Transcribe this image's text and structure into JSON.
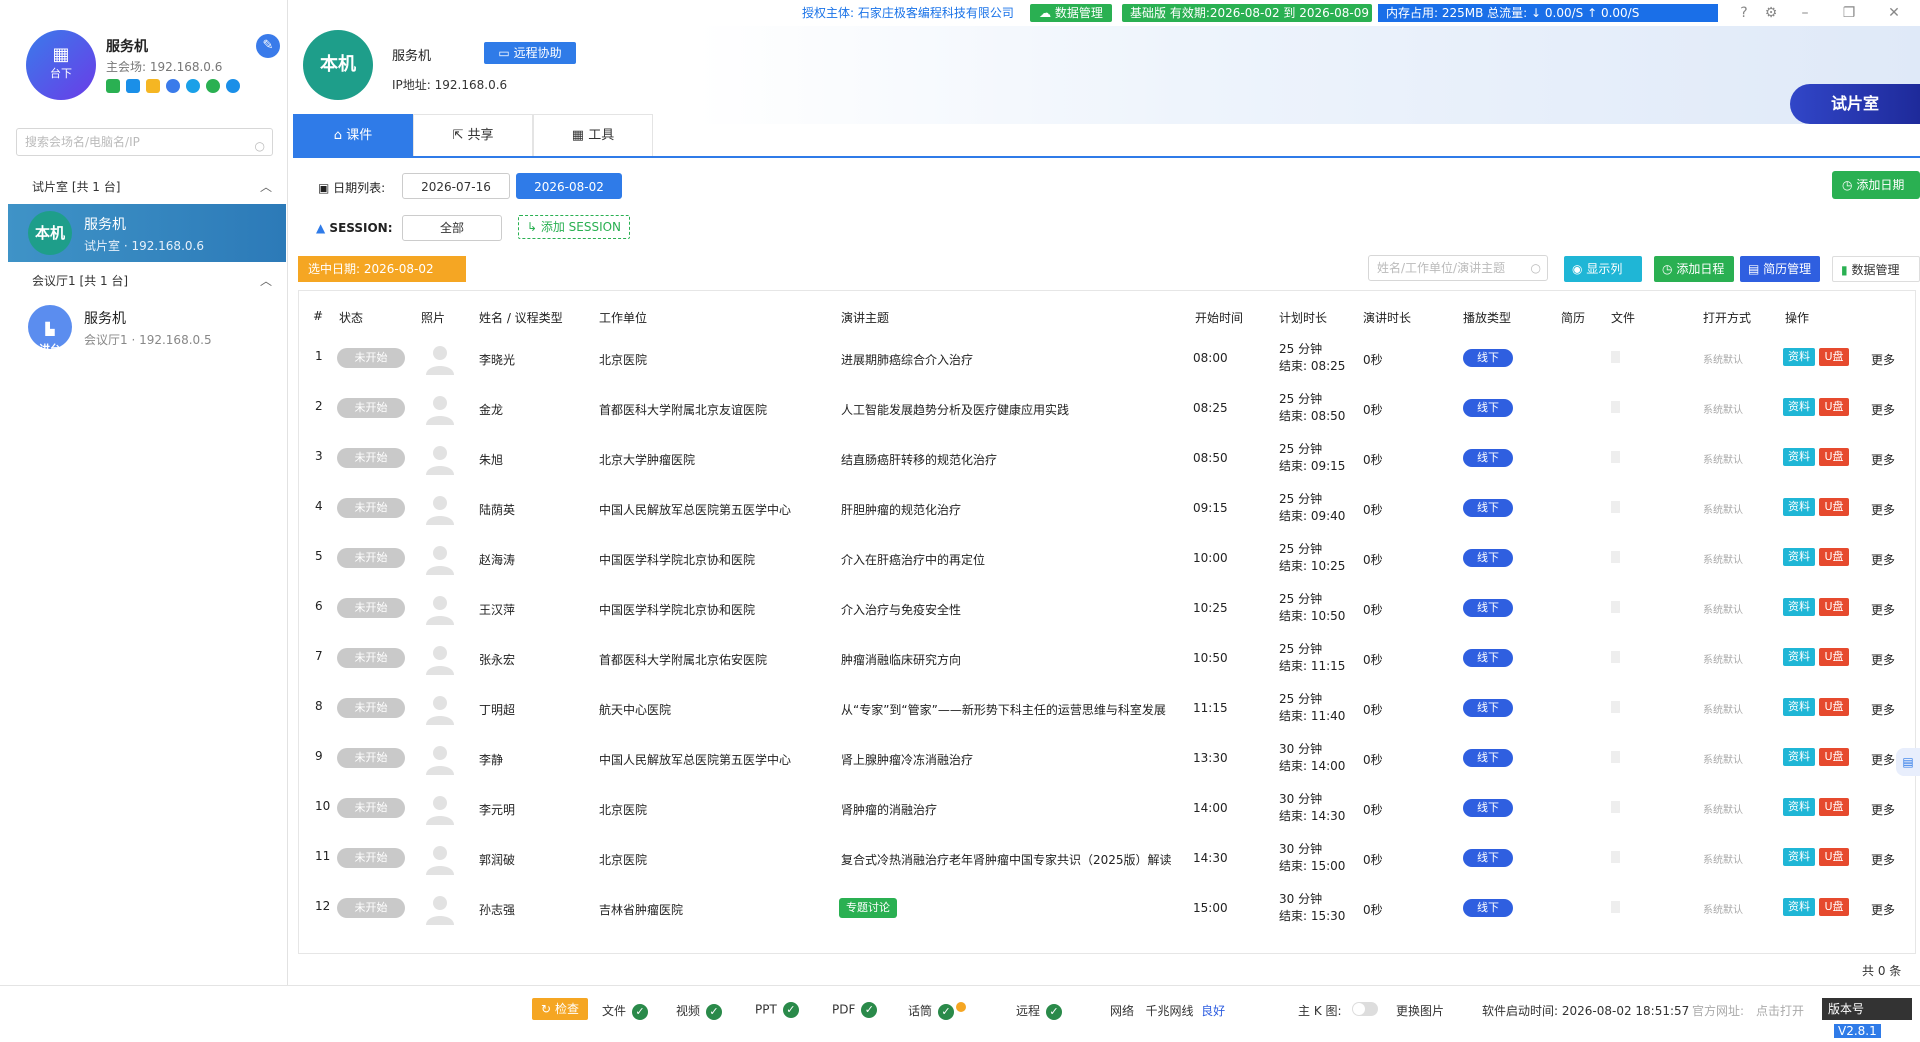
{
  "topbar": {
    "license_label": "授权主体:",
    "license_org": "石家庄极客编程科技有限公司",
    "data_manage": "数据管理",
    "version_text": "基础版 有效期:2026-08-02 到 2026-08-09",
    "memory_text": "内存占用: 225MB   总流量: ↓ 0.00/S   ↑ 0.00/S"
  },
  "sidebar": {
    "server": {
      "avatar_label": "台下",
      "name": "服务机",
      "main_ip": "主会场: 192.168.0.6"
    },
    "search_placeholder": "搜索会场名/电脑名/IP",
    "groups": [
      {
        "title": "试片室  [共 1 台]",
        "devices": [
          {
            "avatar": "本机",
            "name": "服务机",
            "sub": "试片室 · 192.168.0.6",
            "color": "#1e9e8a"
          }
        ]
      },
      {
        "title": "会议厅1  [共 1 台]",
        "devices": [
          {
            "avatar": "讲台",
            "name": "服务机",
            "sub": "会议厅1 · 192.168.0.5",
            "color": "#5b8def"
          }
        ]
      }
    ]
  },
  "header": {
    "avatar_label": "本机",
    "name": "服务机",
    "remote_btn": "远程协助",
    "ip": "IP地址: 192.168.0.6",
    "room_tag": "试片室"
  },
  "tabs": [
    {
      "label": "课件",
      "icon": "courseware-icon"
    },
    {
      "label": "共享",
      "icon": "share-icon"
    },
    {
      "label": "工具",
      "icon": "tools-icon"
    }
  ],
  "date_row": {
    "label": "日期列表:",
    "dates": [
      "2026-07-16",
      "2026-08-02"
    ],
    "add_date": "添加日期"
  },
  "session_row": {
    "label": "SESSION:",
    "current": "全部",
    "add_session": "添加 SESSION"
  },
  "toolbar": {
    "selected_date": "选中日期:  2026-08-02",
    "filter_placeholder": "姓名/工作单位/演讲主题",
    "show_cols": "显示列",
    "add_schedule": "添加日程",
    "cv_manage": "简历管理",
    "data_manage": "数据管理"
  },
  "table": {
    "headers": [
      "#",
      "状态",
      "照片",
      "姓名 / 议程类型",
      "工作单位",
      "演讲主题",
      "开始时间",
      "计划时长",
      "演讲时长",
      "播放类型",
      "简历",
      "文件",
      "打开方式",
      "操作"
    ],
    "rows": [
      {
        "no": "1",
        "status": "未开始",
        "name": "李晓光",
        "org": "北京医院",
        "topic": "进展期肺癌综合介入治疗",
        "start": "08:00",
        "plan": "25 分钟",
        "end": "结束: 08:25",
        "speak": "0秒",
        "play": "线下",
        "open": "系统默认"
      },
      {
        "no": "2",
        "status": "未开始",
        "name": "金龙",
        "org": "首都医科大学附属北京友谊医院",
        "topic": "人工智能发展趋势分析及医疗健康应用实践",
        "start": "08:25",
        "plan": "25 分钟",
        "end": "结束: 08:50",
        "speak": "0秒",
        "play": "线下",
        "open": "系统默认"
      },
      {
        "no": "3",
        "status": "未开始",
        "name": "朱旭",
        "org": "北京大学肿瘤医院",
        "topic": "结直肠癌肝转移的规范化治疗",
        "start": "08:50",
        "plan": "25 分钟",
        "end": "结束: 09:15",
        "speak": "0秒",
        "play": "线下",
        "open": "系统默认"
      },
      {
        "no": "4",
        "status": "未开始",
        "name": "陆荫英",
        "org": "中国人民解放军总医院第五医学中心",
        "topic": "肝胆肿瘤的规范化治疗",
        "start": "09:15",
        "plan": "25 分钟",
        "end": "结束: 09:40",
        "speak": "0秒",
        "play": "线下",
        "open": "系统默认"
      },
      {
        "no": "5",
        "status": "未开始",
        "name": "赵海涛",
        "org": "中国医学科学院北京协和医院",
        "topic": "介入在肝癌治疗中的再定位",
        "start": "10:00",
        "plan": "25 分钟",
        "end": "结束: 10:25",
        "speak": "0秒",
        "play": "线下",
        "open": "系统默认"
      },
      {
        "no": "6",
        "status": "未开始",
        "name": "王汉萍",
        "org": "中国医学科学院北京协和医院",
        "topic": "介入治疗与免疫安全性",
        "start": "10:25",
        "plan": "25 分钟",
        "end": "结束: 10:50",
        "speak": "0秒",
        "play": "线下",
        "open": "系统默认"
      },
      {
        "no": "7",
        "status": "未开始",
        "name": "张永宏",
        "org": "首都医科大学附属北京佑安医院",
        "topic": "肿瘤消融临床研究方向",
        "start": "10:50",
        "plan": "25 分钟",
        "end": "结束: 11:15",
        "speak": "0秒",
        "play": "线下",
        "open": "系统默认"
      },
      {
        "no": "8",
        "status": "未开始",
        "name": "丁明超",
        "org": "航天中心医院",
        "topic": "从“专家”到“管家”——新形势下科主任的运营思维与科室发展",
        "start": "11:15",
        "plan": "25 分钟",
        "end": "结束: 11:40",
        "speak": "0秒",
        "play": "线下",
        "open": "系统默认"
      },
      {
        "no": "9",
        "status": "未开始",
        "name": "李静",
        "org": "中国人民解放军总医院第五医学中心",
        "topic": "肾上腺肿瘤冷冻消融治疗",
        "start": "13:30",
        "plan": "30 分钟",
        "end": "结束: 14:00",
        "speak": "0秒",
        "play": "线下",
        "open": "系统默认"
      },
      {
        "no": "10",
        "status": "未开始",
        "name": "李元明",
        "org": "北京医院",
        "topic": "肾肿瘤的消融治疗",
        "start": "14:00",
        "plan": "30 分钟",
        "end": "结束: 14:30",
        "speak": "0秒",
        "play": "线下",
        "open": "系统默认"
      },
      {
        "no": "11",
        "status": "未开始",
        "name": "郭润破",
        "org": "北京医院",
        "topic": "复合式冷热消融治疗老年肾肿瘤中国专家共识（2025版）解读",
        "start": "14:30",
        "plan": "30 分钟",
        "end": "结束: 15:00",
        "speak": "0秒",
        "play": "线下",
        "open": "系统默认"
      },
      {
        "no": "12",
        "status": "未开始",
        "name": "孙志强",
        "org": "吉林省肿瘤医院",
        "topic": "专题讨论",
        "topic_tag": true,
        "start": "15:00",
        "plan": "30 分钟",
        "end": "结束: 15:30",
        "speak": "0秒",
        "play": "线下",
        "open": "系统默认"
      }
    ],
    "row_actions": {
      "info": "资料",
      "usb": "U盘",
      "more": "更多"
    },
    "footer": "共 0 条"
  },
  "statusbar": {
    "check": "检查",
    "items": [
      "文件",
      "视频",
      "PPT",
      "PDF",
      "话筒",
      "远程"
    ],
    "network_label": "网络",
    "network_type": "千兆网线",
    "network_status": "良好",
    "main_k": "主 K 图:",
    "change_pic": "更换图片",
    "start_time": "软件启动时间:  2026-08-02 18:51:57",
    "official": "官方网址:",
    "open_link": "点击打开",
    "version_label": "版本号",
    "version": "V2.8.1"
  },
  "colors": {
    "accent": "#2f7be8",
    "green": "#2ab052",
    "orange": "#f5a623",
    "red": "#e64a2e",
    "cyan": "#1fb6d6"
  }
}
